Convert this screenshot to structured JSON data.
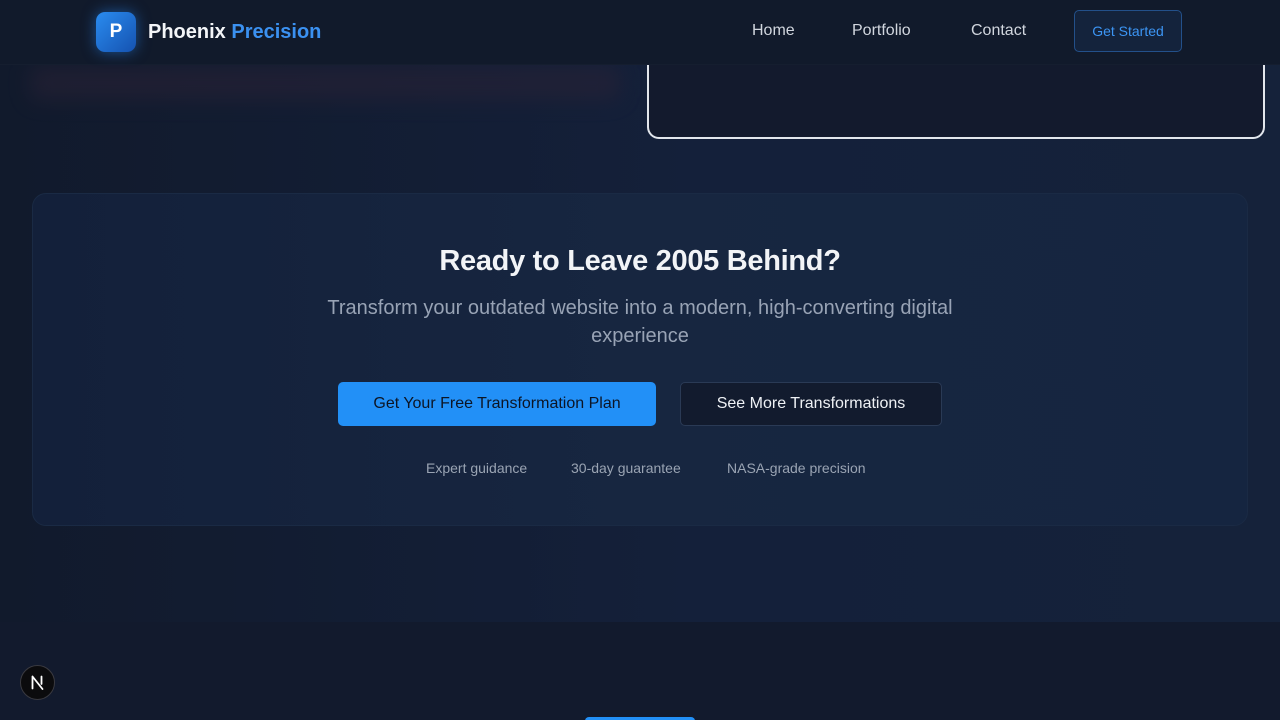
{
  "header": {
    "logo_letter": "P",
    "brand_name": "Phoenix",
    "brand_accent": "Precision",
    "nav": {
      "home": "Home",
      "portfolio": "Portfolio",
      "contact": "Contact"
    },
    "cta_label": "Get Started"
  },
  "cta_section": {
    "title": "Ready to Leave 2005 Behind?",
    "subtitle": "Transform your outdated website into a modern, high-converting digital experience",
    "primary_button": "Get Your Free Transformation Plan",
    "secondary_button": "See More Transformations",
    "features": [
      "Expert guidance",
      "30-day guarantee",
      "NASA-grade precision"
    ]
  },
  "colors": {
    "accent": "#2290f7",
    "brand_accent": "#3b91f1",
    "background": "#131b2e"
  },
  "icons": {
    "next_badge": "nextjs-icon"
  }
}
